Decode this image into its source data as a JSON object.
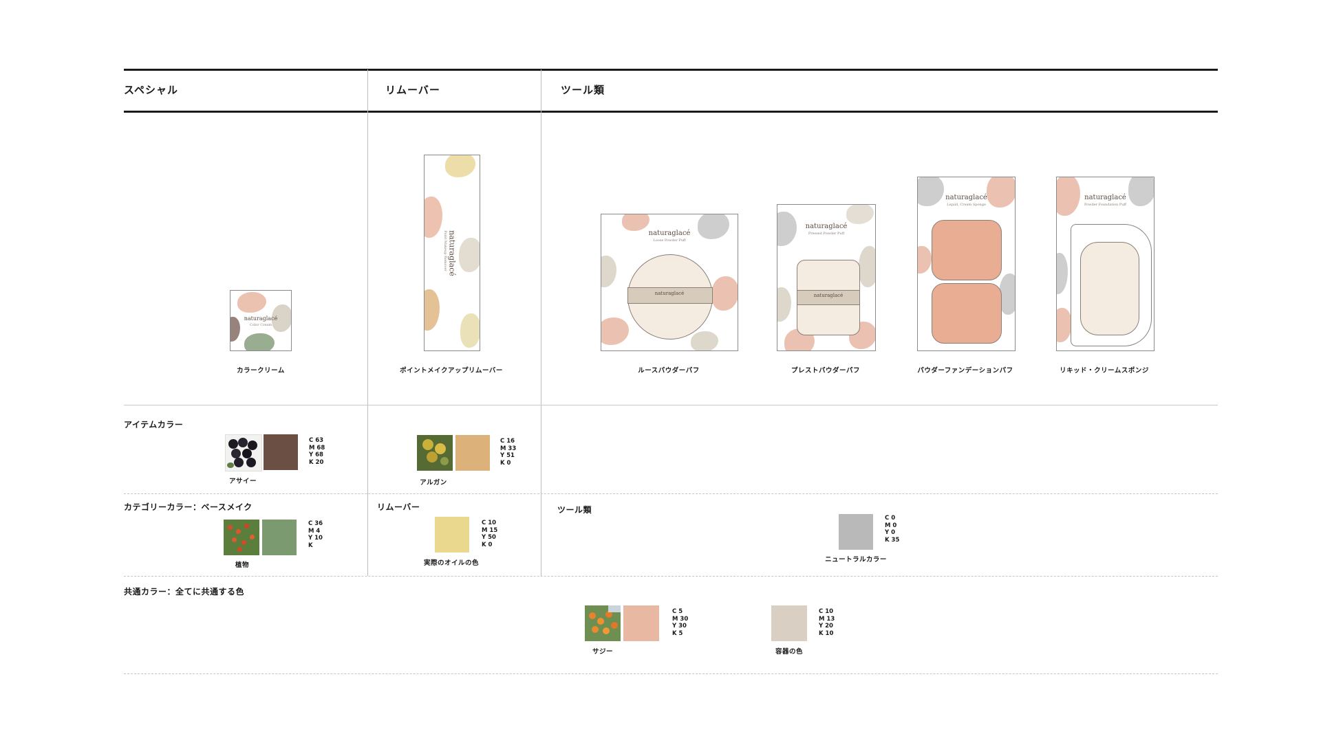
{
  "columns": {
    "special": "スペシャル",
    "remover": "リムーバー",
    "tools": "ツール類"
  },
  "brand": "naturaglacé",
  "products": {
    "color_cream": {
      "label": "カラークリーム",
      "sub": "Color Cream"
    },
    "point_remover": {
      "label": "ポイントメイクアップリムーバー",
      "sub": "Point Makeup Remover"
    },
    "loose_puff": {
      "label": "ルースパウダーパフ",
      "sub": "Loose Powder Puff"
    },
    "pressed_puff": {
      "label": "プレストパウダーパフ",
      "sub": "Pressed Powder Puff"
    },
    "foundation_puff": {
      "label": "パウダーファンデーションパフ",
      "sub": "Liquid, Cream Sponge"
    },
    "liquid_sponge": {
      "label": "リキッド・クリームスポンジ",
      "sub": "Powder Foundation Puff"
    }
  },
  "item_color": {
    "heading": "アイテムカラー",
    "acai": {
      "label": "アサイー",
      "cmyk": "C 63\nM 68\nY 68\nK 20",
      "color": "#6b4f45"
    },
    "argan": {
      "label": "アルガン",
      "cmyk": "C 16\nM 33\nY 51\nK 0",
      "color": "#ddb27a"
    }
  },
  "category_color": {
    "heading": "カテゴリーカラー：ベースメイク",
    "plant": {
      "label": "植物",
      "cmyk": "C 36\nM 4\nY 10\nK",
      "color": "#7c9a6f"
    },
    "remover_heading": "リムーバー",
    "oil": {
      "label": "実際のオイルの色",
      "cmyk": "C 10\nM 15\nY 50\nK 0",
      "color": "#ead88e"
    },
    "tools_heading": "ツール類",
    "neutral": {
      "label": "ニュートラルカラー",
      "cmyk": "C 0\nM 0\nY 0\nK 35",
      "color": "#b9b9b9"
    }
  },
  "common_color": {
    "heading": "共通カラー：全てに共通する色",
    "sea_buckthorn": {
      "label": "サジー",
      "cmyk": "C 5\nM 30\nY 30\nK 5",
      "color": "#e8b8a2"
    },
    "container": {
      "label": "容器の色",
      "cmyk": "C 10\nM 13\nY 20\nK 10",
      "color": "#d9d0c3"
    }
  }
}
